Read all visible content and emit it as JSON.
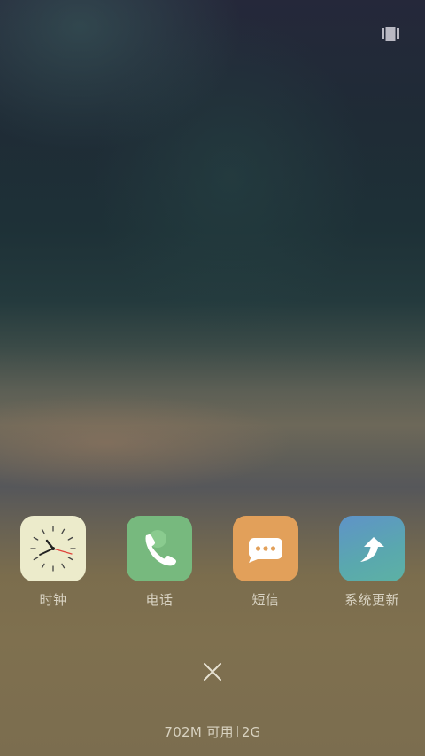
{
  "colors": {
    "clock_tile": "#ecebcb",
    "phone_tile": "#77b97e",
    "sms_tile": "#e2a05a",
    "update_tile_start": "#5f93c8",
    "update_tile_end": "#5db1a4",
    "label_text": "#d8d2c2"
  },
  "recents": {
    "icon": "recents-icon"
  },
  "dock": {
    "apps": [
      {
        "label": "时钟",
        "icon": "clock-icon"
      },
      {
        "label": "电话",
        "icon": "phone-icon"
      },
      {
        "label": "短信",
        "icon": "message-icon"
      },
      {
        "label": "系统更新",
        "icon": "update-arrow-icon"
      }
    ]
  },
  "close": {
    "icon": "close-icon"
  },
  "memory": {
    "available": "702M 可用",
    "total": "2G"
  }
}
